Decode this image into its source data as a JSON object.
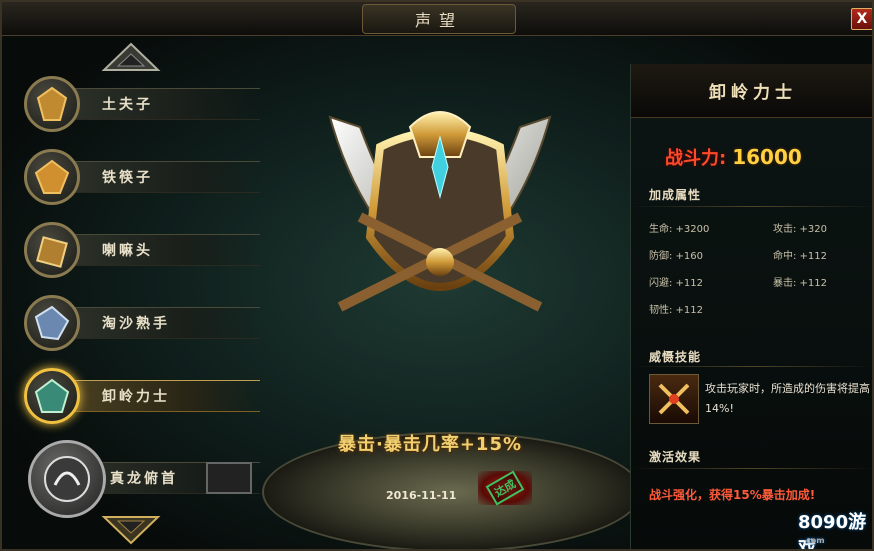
{
  "window": {
    "title": "声望",
    "close_label": "X"
  },
  "ranks": [
    {
      "label": "土夫子",
      "icon": "shovel-badge-icon",
      "active": false
    },
    {
      "label": "铁筷子",
      "icon": "iron-badge-icon",
      "active": false
    },
    {
      "label": "喇嘛头",
      "icon": "lama-badge-icon",
      "active": false
    },
    {
      "label": "淘沙熟手",
      "icon": "crystal-badge-icon",
      "active": false
    },
    {
      "label": "卸岭力士",
      "icon": "jade-badge-icon",
      "active": true
    },
    {
      "label": "真龙俯首",
      "icon": "dragon-badge-icon",
      "active": false
    }
  ],
  "center": {
    "bonus": "暴击·暴击几率+15%",
    "date": "2016-11-11",
    "stamp": "达成"
  },
  "detail": {
    "name": "卸岭力士",
    "power_label": "战斗力:",
    "power_value": "16000",
    "attr_title": "加成属性",
    "stats": [
      {
        "l": "生命: +3200",
        "r": "攻击: +320"
      },
      {
        "l": "防御: +160",
        "r": "命中: +112"
      },
      {
        "l": "闪避: +112",
        "r": "暴击: +112"
      },
      {
        "l": "韧性: +112",
        "r": ""
      }
    ],
    "skill_title": "威慑技能",
    "skill_desc": "攻击玩家时，所造成的伤害将提高14%!",
    "effect_title": "激活效果",
    "effect_text": "战斗强化，获得15%暴击加成!"
  },
  "logo": {
    "num": "8090",
    "text": "游戏",
    "sub": "com"
  },
  "colors": {
    "accent_gold": "#f0d070",
    "power_red": "#ff4a2a",
    "effect_red": "#ff5a3a"
  }
}
